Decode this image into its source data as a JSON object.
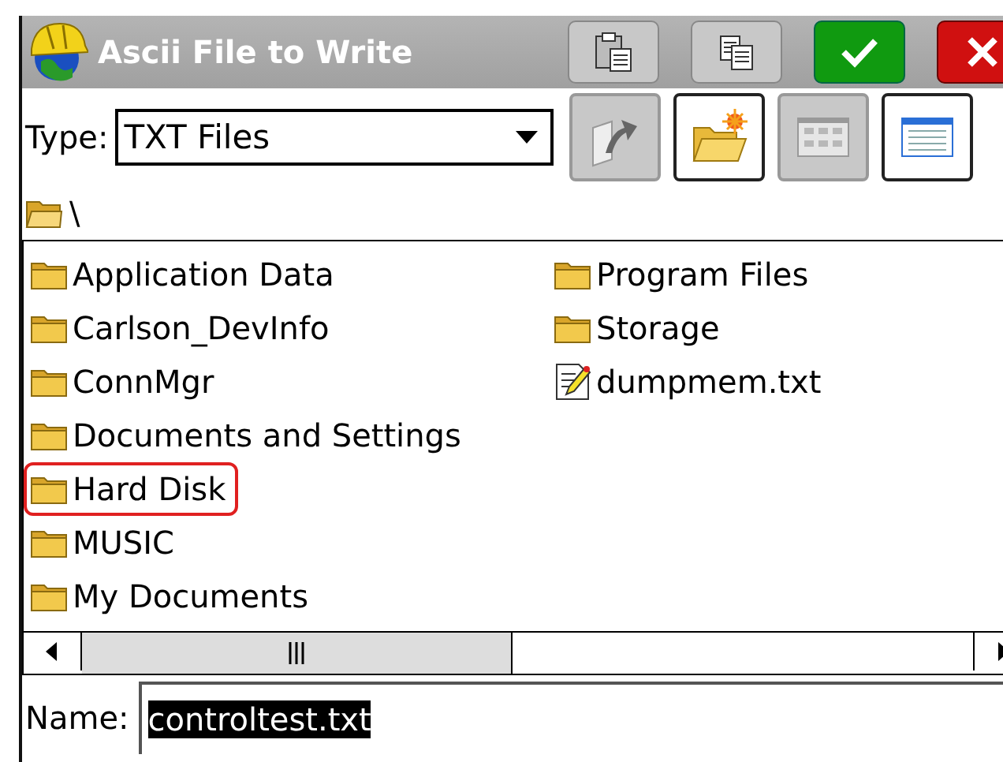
{
  "window": {
    "title": "Ascii File to Write"
  },
  "title_buttons": [
    {
      "kind": "paste"
    },
    {
      "kind": "copy"
    },
    {
      "kind": "ok"
    },
    {
      "kind": "cancel"
    }
  ],
  "type_field": {
    "label": "Type:",
    "value": "TXT Files"
  },
  "toolbar": [
    {
      "kind": "up",
      "disabled": true
    },
    {
      "kind": "new-folder",
      "disabled": false
    },
    {
      "kind": "list-view",
      "disabled": true
    },
    {
      "kind": "details-view",
      "disabled": false
    }
  ],
  "path": "\\",
  "files": [
    {
      "kind": "folder",
      "name": "Application Data",
      "highlighted": false
    },
    {
      "kind": "folder",
      "name": "Carlson_DevInfo",
      "highlighted": false
    },
    {
      "kind": "folder",
      "name": "ConnMgr",
      "highlighted": false
    },
    {
      "kind": "folder",
      "name": "Documents and Settings",
      "highlighted": false
    },
    {
      "kind": "folder",
      "name": "Hard Disk",
      "highlighted": true
    },
    {
      "kind": "folder",
      "name": "MUSIC",
      "highlighted": false
    },
    {
      "kind": "folder",
      "name": "My Documents",
      "highlighted": false
    },
    {
      "kind": "folder",
      "name": "Program Files",
      "highlighted": false
    },
    {
      "kind": "folder",
      "name": "Storage",
      "highlighted": false
    },
    {
      "kind": "text-file",
      "name": "dumpmem.txt",
      "highlighted": false
    }
  ],
  "name_field": {
    "label": "Name:",
    "value": "controltest.txt",
    "text_selected": true
  }
}
